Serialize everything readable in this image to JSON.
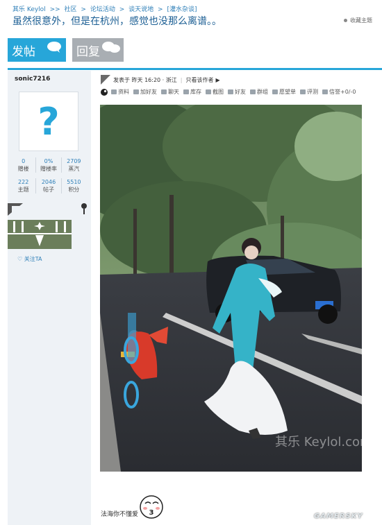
{
  "breadcrumb": [
    "其乐 Keylol",
    "社区",
    "论坛活动",
    "谈天说地",
    "[灌水杂谈]"
  ],
  "breadcrumb_separators": [
    ">>",
    ">",
    ">",
    ">"
  ],
  "thread": {
    "title": "虽然很意外，但是在杭州，感觉也没那么离谱。。",
    "favorite_label": "收藏主题"
  },
  "buttons": {
    "post": "发帖",
    "reply": "回复"
  },
  "user": {
    "name": "sonic7216",
    "avatar_glyph": "?",
    "stats_row1": [
      {
        "value": "0",
        "label": "赠楼"
      },
      {
        "value": "0%",
        "label": "赠楼率"
      },
      {
        "value": "2709",
        "label": "蒸汽"
      }
    ],
    "stats_row2": [
      {
        "value": "222",
        "label": "主题"
      },
      {
        "value": "2046",
        "label": "帖子"
      },
      {
        "value": "5510",
        "label": "积分"
      }
    ],
    "follow_label": "关注TA"
  },
  "post": {
    "meta": "发表于 昨天 16:20 · 浙江",
    "only_author": "只看该作者",
    "toolbar": [
      "资料",
      "加好友",
      "聊天",
      "库存",
      "截图",
      "好友",
      "群组",
      "愿望单",
      "评测",
      "信誉+0/-0"
    ],
    "caption": "法海你不懂爱",
    "meme_text": "3",
    "watermark": "其乐 Keylol.com"
  },
  "site_watermark": "GAMERSKY",
  "colors": {
    "accent": "#27a6d9",
    "link": "#2e7fb8",
    "title": "#1c5f94",
    "sidebar": "#eef2f6",
    "medal": "#6b7e5b"
  }
}
